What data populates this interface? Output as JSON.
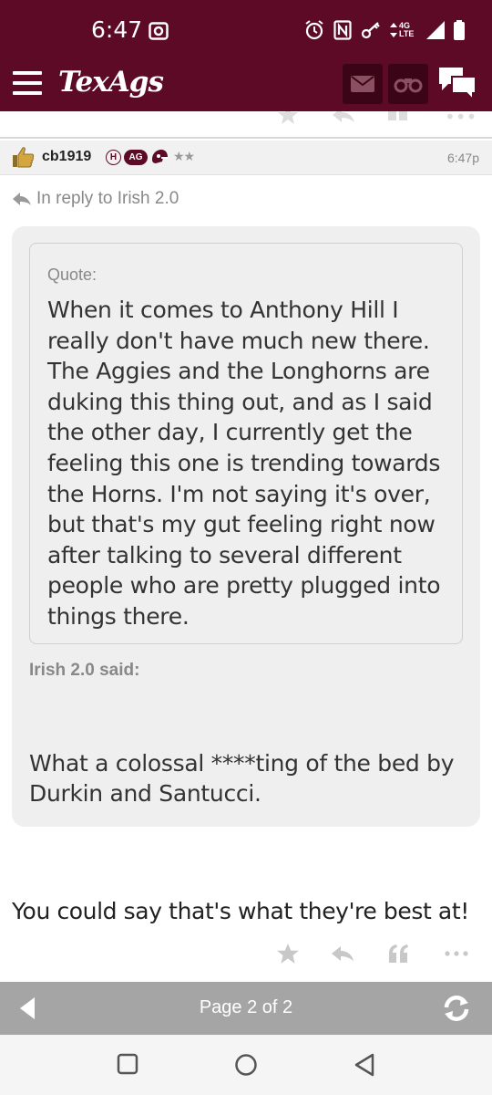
{
  "status_bar": {
    "time": "6:47",
    "network": "4G LTE",
    "icons": [
      "screen-record-icon",
      "alarm-icon",
      "nfc-icon",
      "key-icon",
      "data-arrows-icon",
      "signal-icon",
      "battery-icon"
    ]
  },
  "app": {
    "logo": "TexAgs",
    "brand_color": "#5c0a25",
    "header_buttons": [
      "mail-icon",
      "binoculars-icon",
      "chat-icon"
    ]
  },
  "post": {
    "username": "cb1919",
    "badge_h": "H",
    "badge_ag": "AG",
    "stars": "★★",
    "time": "6:47p",
    "reply_to": "In reply to Irish 2.0",
    "quote_label": "Quote:",
    "quote_text": "When it comes to Anthony Hill I really don't have much new there. The Aggies and the Longhorns are duking this thing out, and as I said the other day, I currently get the feeling this one is trending towards the Horns. I'm not saying it's over, but that's my gut feeling right now after talking to several different people who are pretty plugged into things there.",
    "quoted_user_said": "Irish 2.0 said:",
    "quoted_reply": "What a colossal ****ting of the bed by Durkin and Santucci.",
    "body": "You could say that's what they're best at!"
  },
  "pagination": {
    "label": "Page 2 of 2"
  },
  "colors": {
    "header": "#5c0a25",
    "pager": "#a5a5a5",
    "quote_bg": "#efefef"
  }
}
